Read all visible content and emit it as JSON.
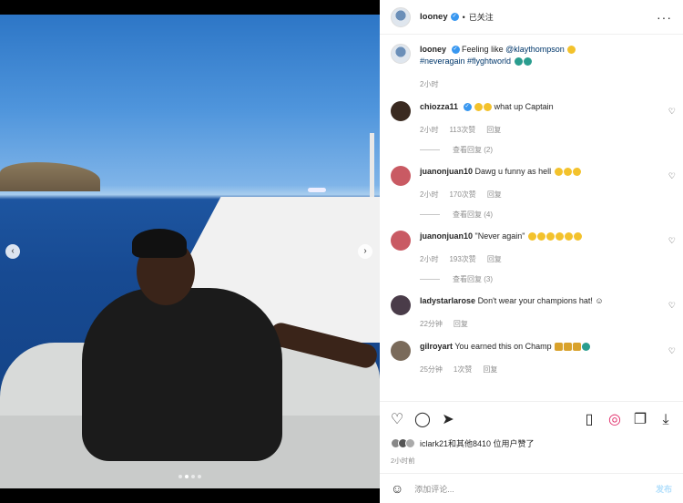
{
  "header": {
    "username": "looney",
    "verified_glyph": "✓",
    "separator": "•",
    "follow_label": "已关注",
    "more_icon": "···"
  },
  "media": {
    "prev_icon": "‹",
    "next_icon": "›"
  },
  "caption": {
    "username": "looney",
    "text": "Feeling like ",
    "mention": "@klaythompson",
    "hashtags": "#neveragain #flyghtworld",
    "time": "2小时"
  },
  "comments": [
    {
      "username": "chiozza11",
      "text": " what up Captain",
      "time": "2小时",
      "likes": "113次赞",
      "reply": "回复",
      "replies": "查看回复 (2)",
      "avatar_color": "#3a2a20"
    },
    {
      "username": "juanonjuan10",
      "text": "Dawg u funny as hell",
      "time": "2小时",
      "likes": "170次赞",
      "reply": "回复",
      "replies": "查看回复 (4)",
      "avatar_color": "#c95a63"
    },
    {
      "username": "juanonjuan10",
      "text": "\"Never again\"",
      "time": "2小时",
      "likes": "193次赞",
      "reply": "回复",
      "replies": "查看回复 (3)",
      "avatar_color": "#c95a63"
    },
    {
      "username": "ladystarlarose",
      "text": "Don't wear your champions hat! ☺",
      "time": "22分钟",
      "reply": "回复",
      "avatar_color": "#4a3c49"
    },
    {
      "username": "gilroyart",
      "text": "You earned this on Champ",
      "time": "25分钟",
      "likes": "1次赞",
      "reply": "回复",
      "avatar_color": "#7a6a5a"
    }
  ],
  "likes_text": "iclark21和其他8410 位用户赞了",
  "time_ago": "2小时前",
  "add_comment": {
    "placeholder": "添加评论...",
    "post_label": "发布"
  },
  "colors": {
    "link": "#00376b",
    "verified": "#3897f0",
    "muted": "#8e8e8e"
  }
}
